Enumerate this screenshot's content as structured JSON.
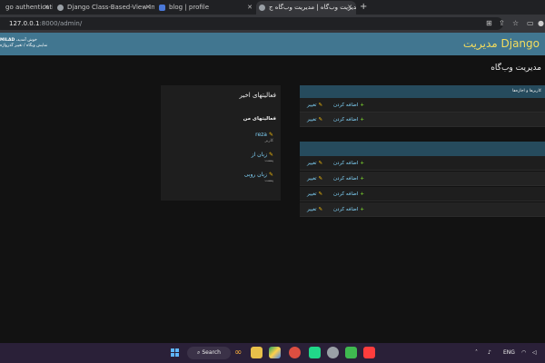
{
  "browser": {
    "tabs": [
      {
        "title": "go authentication"
      },
      {
        "title": "Django Class-Based-View Inspe"
      },
      {
        "title": "blog | profile"
      },
      {
        "title": "مدیریت وب‌گاه | مدیریت ‌وب‌گاه ج"
      }
    ],
    "new_tab": "+",
    "url_host": "127.0.0.1",
    "url_path": ":8000/admin/"
  },
  "admin": {
    "brand": "Django مدیریت",
    "welcome": "خوش آمدید،",
    "username": "MILAD",
    "user_links": "نمایش وبگاه / تغییر گذرواژه",
    "page_title": "مدیریت وب‌گاه",
    "module_caption": "کاربرها و اجازه‌ها",
    "add_label": "اضافه کردن",
    "change_label": "تغییر"
  },
  "recent": {
    "title": "فعالیتهای اخیر",
    "my_actions": "فعالیتهای من",
    "items": [
      {
        "name": "reza",
        "type": "کاربر"
      },
      {
        "name": "زبان از",
        "type": "پست"
      },
      {
        "name": "زبان روبی",
        "type": "پست"
      }
    ]
  },
  "taskbar": {
    "search_label": "Search",
    "language": "ENG"
  }
}
